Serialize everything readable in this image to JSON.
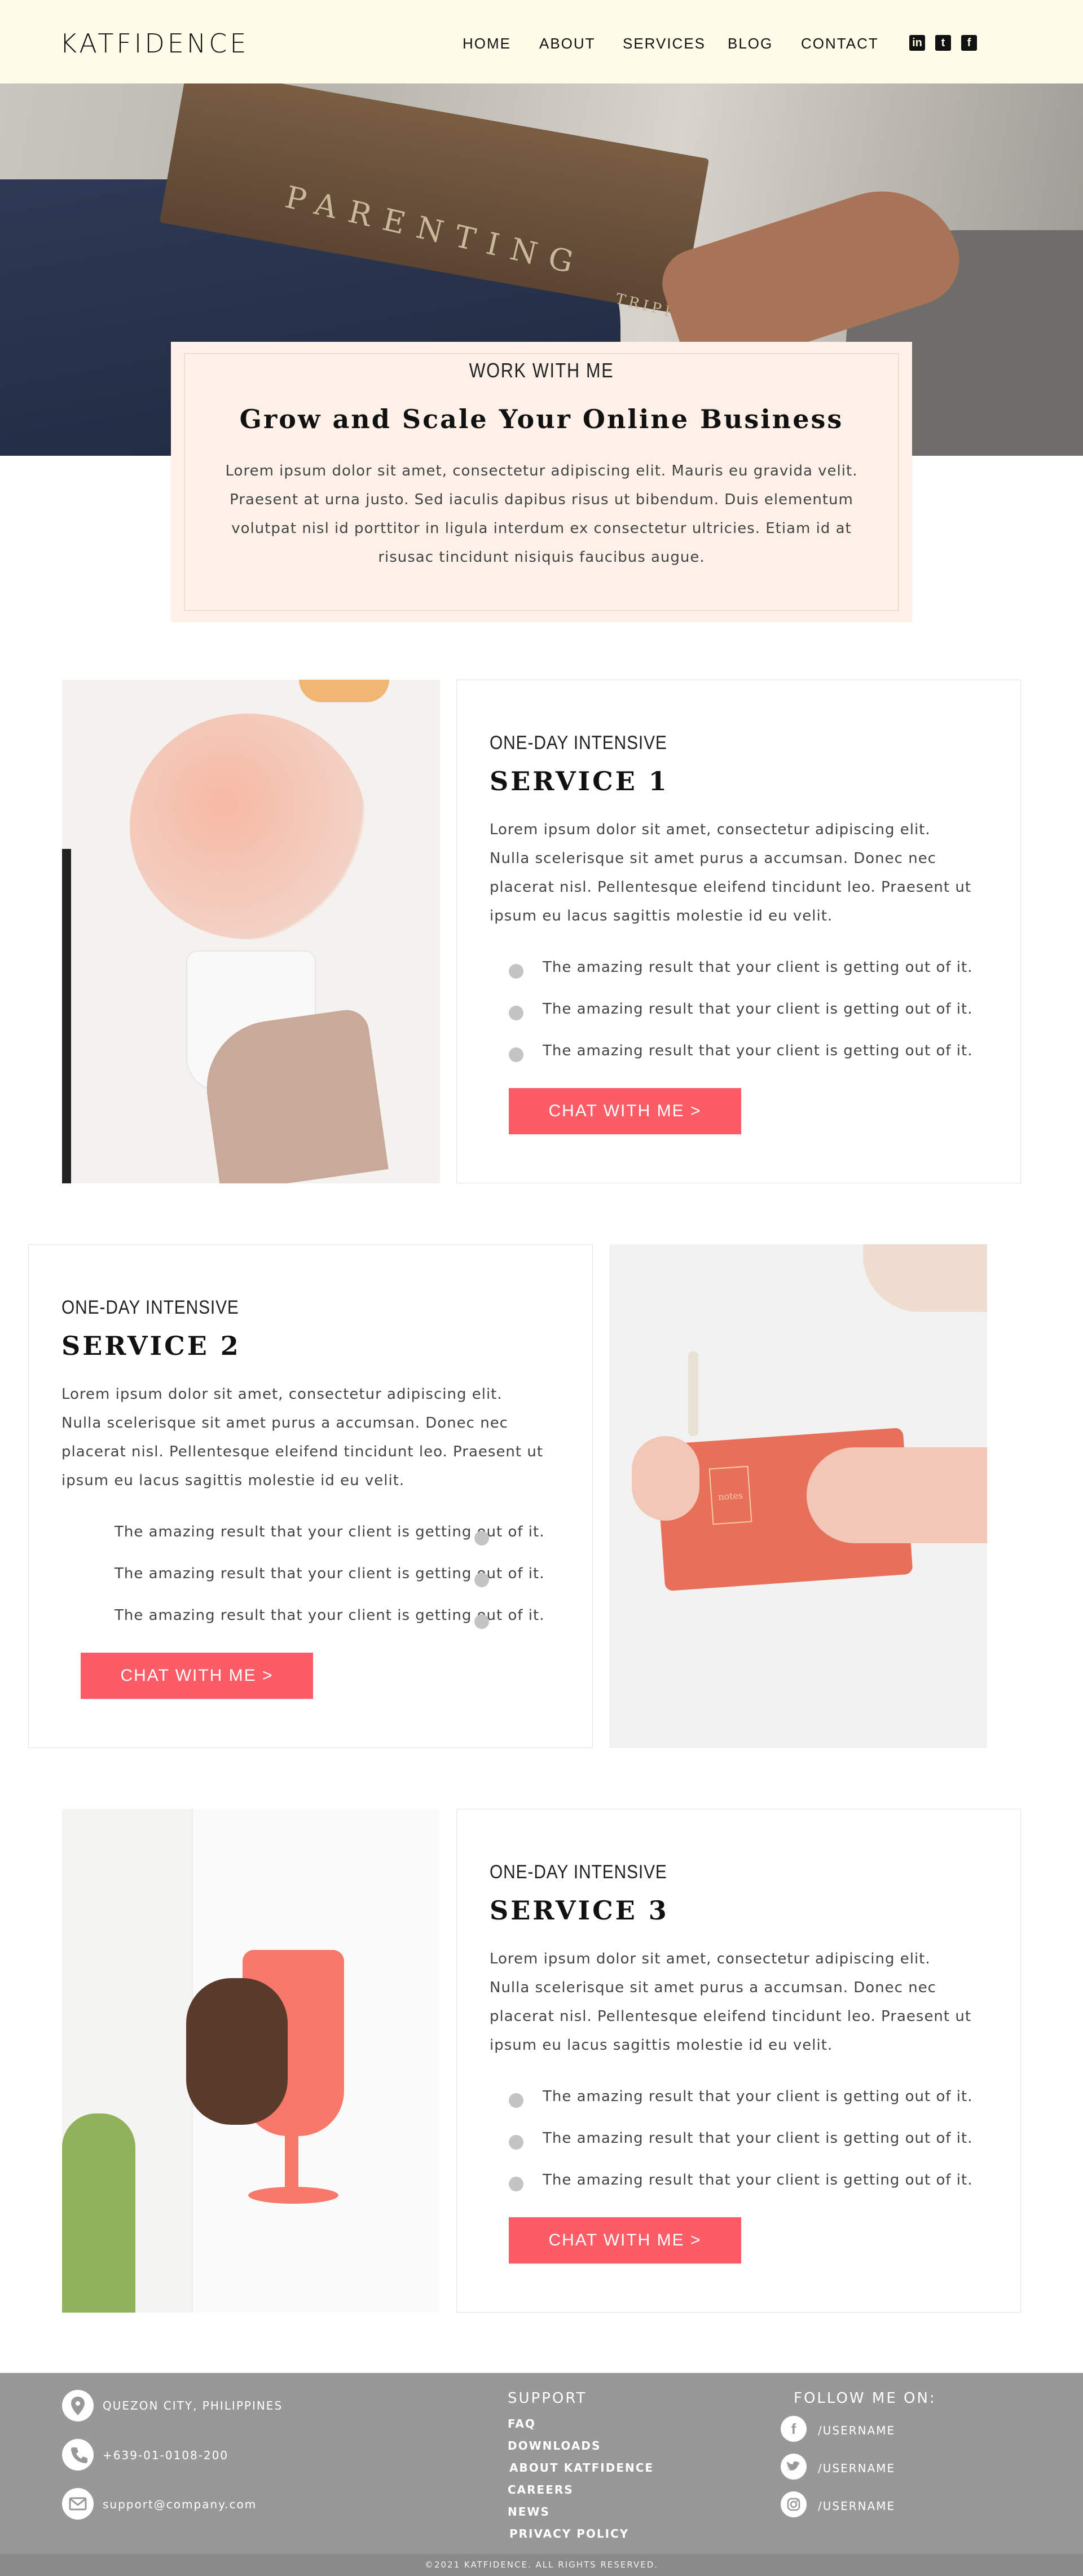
{
  "header": {
    "logo": "KATFIDENCE",
    "nav": [
      "HOME",
      "ABOUT",
      "SERVICES",
      "BLOG",
      "CONTACT"
    ],
    "social_icons": [
      "linkedin-icon",
      "tumblr-icon",
      "facebook-icon"
    ],
    "background_color": "#fefce8"
  },
  "hero": {
    "book_text": "PARENTING",
    "book_author": "TRIPP"
  },
  "intro": {
    "eyebrow": "WORK WITH ME",
    "title": "Grow and Scale Your Online Business",
    "body": "Lorem ipsum dolor sit amet, consectetur adipiscing elit. Mauris eu gravida velit. Praesent at urna justo. Sed iaculis dapibus risus ut bibendum. Duis elementum volutpat nisl id porttitor in ligula interdum ex consectetur ultricies. Etiam id at risusac tincidunt nisiquis faucibus augue.",
    "background_color": "#fdf0e8"
  },
  "services": [
    {
      "eyebrow": "ONE-DAY INTENSIVE",
      "title": "SERVICE 1",
      "body": "Lorem ipsum dolor sit amet, consectetur adipiscing elit. Nulla scelerisque sit amet purus a accumsan. Donec nec placerat nisl. Pellentesque eleifend tincidunt leo. Praesent ut ipsum eu lacus sagittis molestie id eu velit.",
      "bullets": [
        "The amazing result that your client is getting out of it.",
        "The amazing result that your client is getting out of it.",
        "The amazing result that your client is getting out of it."
      ],
      "button": "CHAT WITH ME >"
    },
    {
      "eyebrow": "ONE-DAY INTENSIVE",
      "title": "SERVICE 2",
      "body": "Lorem ipsum dolor sit amet, consectetur adipiscing elit. Nulla scelerisque sit amet purus a accumsan. Donec nec placerat nisl. Pellentesque eleifend tincidunt leo. Praesent ut ipsum eu lacus sagittis molestie id eu velit.",
      "bullets": [
        "The amazing result that your client is getting out of it.",
        "The amazing result that your client is getting out of it.",
        "The amazing result that your client is getting out of it."
      ],
      "button": "CHAT WITH ME >",
      "notebook_text": "notes"
    },
    {
      "eyebrow": "ONE-DAY INTENSIVE",
      "title": "SERVICE 3",
      "body": "Lorem ipsum dolor sit amet, consectetur adipiscing elit. Nulla scelerisque sit amet purus a accumsan. Donec nec placerat nisl. Pellentesque eleifend tincidunt leo. Praesent ut ipsum eu lacus sagittis molestie id eu velit.",
      "bullets": [
        "The amazing result that your client is getting out of it.",
        "The amazing result that your client is getting out of it.",
        "The amazing result that your client is getting out of it."
      ],
      "button": "CHAT WITH ME >"
    }
  ],
  "button_color": "#fb5c66",
  "footer": {
    "contact": [
      {
        "icon": "location-pin-icon",
        "text": "QUEZON CITY, PHILIPPINES"
      },
      {
        "icon": "phone-icon",
        "text": "+639-01-0108-200"
      },
      {
        "icon": "mail-icon",
        "text": "support@company.com"
      }
    ],
    "support_heading": "SUPPORT",
    "support_links": [
      "FAQ",
      "DOWNLOADS",
      "ABOUT KATFIDENCE",
      "CAREERS",
      "NEWS",
      "PRIVACY POLICY"
    ],
    "follow_heading": "FOLLOW ME ON:",
    "social": [
      {
        "icon": "facebook-icon",
        "text": "/USERNAME"
      },
      {
        "icon": "twitter-icon",
        "text": "/USERNAME"
      },
      {
        "icon": "instagram-icon",
        "text": "/USERNAME"
      }
    ],
    "copyright": "©2021 KATFIDENCE. ALL RIGHTS RESERVED.",
    "background_color": "#989898"
  }
}
